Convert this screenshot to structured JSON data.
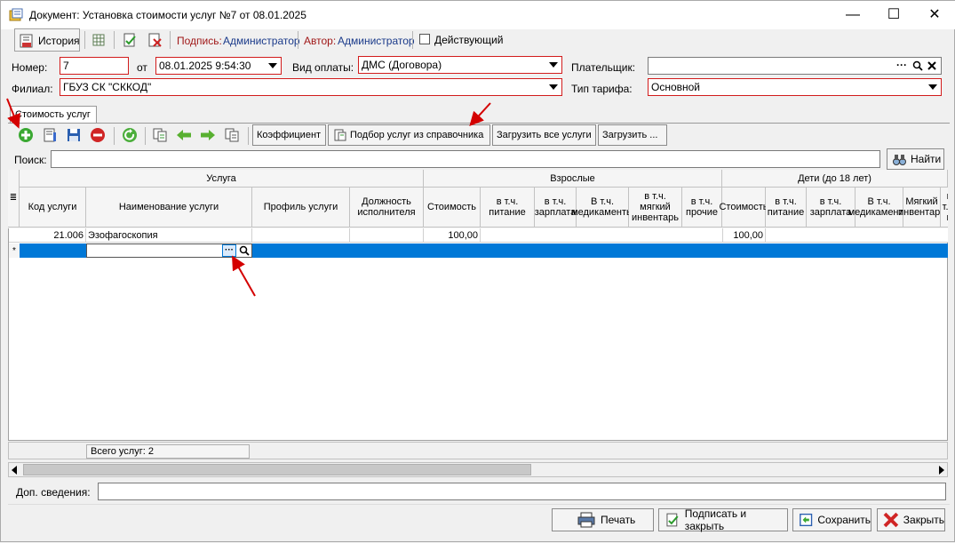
{
  "window": {
    "title": "Документ: Установка стоимости услуг №7 от 08.01.2025",
    "minimize": "—",
    "maximize": "☐",
    "close": "✕"
  },
  "toolbar": {
    "history_label": "История",
    "signature_label": "Подпись:",
    "signature_value": "Администратор",
    "author_label": "Автор:",
    "author_value": "Администратор",
    "active_label": "Действующий",
    "active_checked": false
  },
  "form": {
    "number_label": "Номер:",
    "number_value": "7",
    "date_label": "от",
    "date_value": "08.01.2025 9:54:30",
    "payment_label": "Вид оплаты:",
    "payment_value": "ДМС (Договора)",
    "payer_label": "Плательщик:",
    "payer_value": "",
    "branch_label": "Филиал:",
    "branch_value": "ГБУЗ СК \"СККОД\"",
    "tariff_label": "Тип тарифа:",
    "tariff_value": "Основной"
  },
  "tab": {
    "label": "Стоимость услуг"
  },
  "services_toolbar": {
    "coefficient": "Коэффициент",
    "pick_from_catalog": "Подбор услуг из справочника",
    "load_all": "Загрузить все услуги",
    "load_more": "Загрузить ..."
  },
  "search": {
    "label": "Поиск:",
    "value": "",
    "find_button": "Найти"
  },
  "grid": {
    "group_headers": {
      "service": "Услуга",
      "adults": "Взрослые",
      "children": "Дети (до 18 лет)"
    },
    "columns": {
      "code": "Код услуги",
      "name": "Наименование услуги",
      "profile": "Профиль услуги",
      "position": "Должность исполнителя",
      "cost": "Стоимость",
      "food": "в т.ч. питание",
      "salary": "в т.ч. зарплата",
      "medicines": "В т.ч. медикаменты",
      "soft_inventory": "в т.ч. мягкий инвентарь",
      "other": "в т.ч. прочие",
      "child_cost": "Стоимость",
      "child_food": "в т.ч. питание",
      "child_salary": "в т.ч. зарплата",
      "child_medicines": "В т.ч. медикаменты",
      "child_soft": "Мягкий инвентарь",
      "child_more": "в т.ч. п"
    },
    "rows": [
      {
        "code": "21.006",
        "name": "Эзофагоскопия",
        "profile": "",
        "position": "",
        "cost": "100,00",
        "child_cost": "100,00"
      }
    ],
    "new_row_marker": "*",
    "ellipsis": "···",
    "total_label": "Всего услуг: 2"
  },
  "extra": {
    "label": "Доп. сведения:",
    "value": ""
  },
  "buttons": {
    "print": "Печать",
    "sign_close": "Подписать и закрыть",
    "save": "Сохранить",
    "close": "Закрыть"
  },
  "colors": {
    "selection": "#0078d7",
    "required_border": "#d21c1c",
    "add_green": "#3aa832",
    "delete_red": "#d02525"
  }
}
